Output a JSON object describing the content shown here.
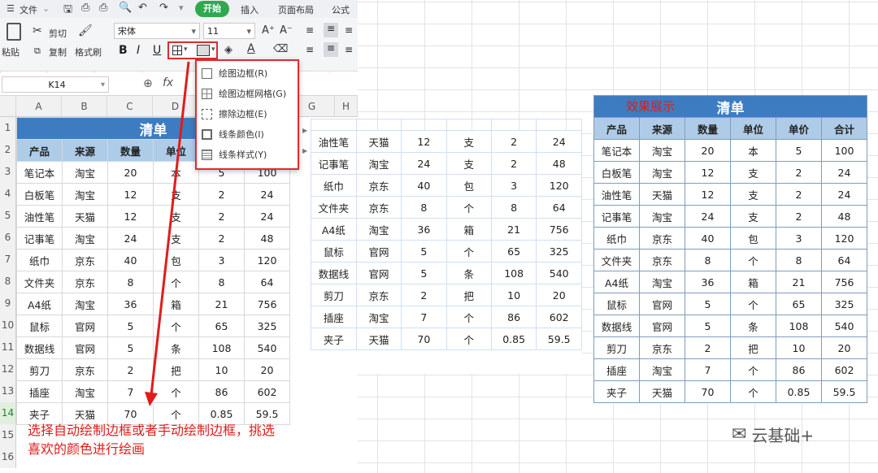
{
  "ribbon": {
    "file_menu": "文件",
    "tabs": [
      "开始",
      "插入",
      "页面布局",
      "公式"
    ],
    "paste_label": "粘贴",
    "cut_label": "剪切",
    "copy_label": "复制",
    "format_painter_label": "格式刷",
    "font_name": "宋体",
    "font_size": "11",
    "bold": "B",
    "italic": "I",
    "underline": "U",
    "grow_font": "A⁺",
    "shrink_font": "A⁻"
  },
  "formula_bar": {
    "cell_ref": "K14",
    "fx_label": "fx"
  },
  "border_menu": {
    "items": [
      "绘图边框(R)",
      "绘图边框网格(G)",
      "擦除边框(E)",
      "线条颜色(I)",
      "线条样式(Y)"
    ]
  },
  "sheet": {
    "col_headers": [
      "A",
      "B",
      "C",
      "D",
      "E",
      "F",
      "G",
      "H"
    ],
    "row_numbers": [
      "1",
      "2",
      "3",
      "4",
      "5",
      "6",
      "7",
      "8",
      "9",
      "10",
      "11",
      "12",
      "13",
      "14",
      "15",
      "16"
    ],
    "title": "清单",
    "headers": [
      "产品",
      "来源",
      "数量",
      "单位",
      "单价",
      "合计"
    ],
    "rows": [
      [
        "笔记本",
        "淘宝",
        "20",
        "本",
        "5",
        "100"
      ],
      [
        "白板笔",
        "淘宝",
        "12",
        "支",
        "2",
        "24"
      ],
      [
        "油性笔",
        "天猫",
        "12",
        "支",
        "2",
        "24"
      ],
      [
        "记事笔",
        "淘宝",
        "24",
        "支",
        "2",
        "48"
      ],
      [
        "纸巾",
        "京东",
        "40",
        "包",
        "3",
        "120"
      ],
      [
        "文件夹",
        "京东",
        "8",
        "个",
        "8",
        "64"
      ],
      [
        "A4纸",
        "淘宝",
        "36",
        "箱",
        "21",
        "756"
      ],
      [
        "鼠标",
        "官网",
        "5",
        "个",
        "65",
        "325"
      ],
      [
        "数据线",
        "官网",
        "5",
        "条",
        "108",
        "540"
      ],
      [
        "剪刀",
        "京东",
        "2",
        "把",
        "10",
        "20"
      ],
      [
        "插座",
        "淘宝",
        "7",
        "个",
        "86",
        "602"
      ],
      [
        "夹子",
        "天猫",
        "70",
        "个",
        "0.85",
        "59.5"
      ]
    ]
  },
  "annotation": {
    "text_line1": "选择自动绘制边框或者手动绘制边框，挑选",
    "text_line2": "喜欢的颜色进行绘画"
  },
  "right_panel": {
    "label": "效果展示",
    "title": "清单"
  },
  "watermark": "云基础+",
  "colors": {
    "title_bg": "#3d7cc1",
    "header_bg": "#aecbe8",
    "highlight_red": "#e01c1c",
    "tab_green": "#2fa84f"
  }
}
